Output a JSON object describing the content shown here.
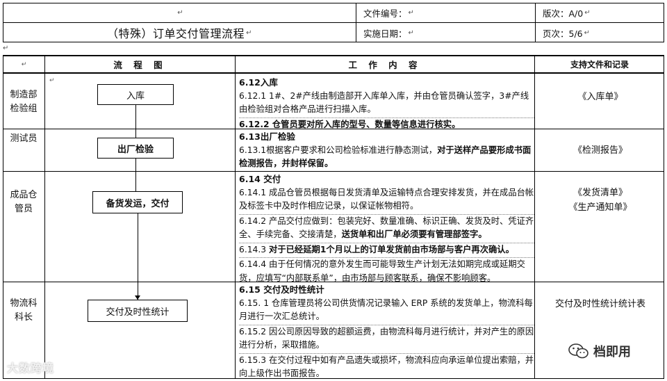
{
  "header": {
    "title_top_mark": "↵",
    "title": "（特殊）订单交付管理流程",
    "doc_no_label": "文件编号：",
    "impl_date_label": "实施日期：",
    "version_label": "版次：A/0",
    "page_label": "页次：5/6",
    "mark": "↵"
  },
  "stray_mark": "↵",
  "table": {
    "col_headers": {
      "dept": "↵",
      "flow": "流 程 图",
      "work": "工 作 内 容",
      "support": "支持文件和记录"
    },
    "rows": [
      {
        "dept": "制造部检验组",
        "dept_line1": "制造部",
        "dept_line2": "检验组",
        "box": "入库",
        "heading": "6.12入库",
        "items": [
          "6.12.1  1#、2#产线由制造部开入库单入库，并由仓管员确认签字，3#产线由检验组对合格产品进行扫描入库。",
          "6.12.2  仓管员要对所入库的型号、数量等信息进行核实。"
        ],
        "support": [
          "《入库单》"
        ]
      },
      {
        "dept_line1": "测试员",
        "box": "出厂检验",
        "heading": "6.13出厂检验",
        "item_plain": "6.13.1根据客户要求和公司检验标准进行静态测试，",
        "item_bold": "对于送样产品要形成书面检测报告，并封样保留。",
        "support": [
          "《检测报告》"
        ]
      },
      {
        "dept_line1": "成品仓",
        "dept_line2": "管员",
        "box": "备货发运，交付",
        "heading": "6.14 交付",
        "item1": "6.14.1 成品仓管员根据每日发货清单及运输特点合理安排发货，并在成品台帐及标签卡中及时作相应记录，以保证帐物相符。",
        "item2_plain": "6.14.2  产品交付应做到：包装完好、数量准确、标识正确、发货及时、凭证齐全、手续完备、交接清楚，",
        "item2_bold": "送货单和出厂单必须要有管理部签字。",
        "item3_plain": "6.14.3  ",
        "item3_bold": "对于已经延期1个月以上的订单发货前由市场部与客户再次确认。",
        "item4": "6.14.4  由于任何情况的意外发生而可能导致生产计划无法如期完成或延期交货，应填写“内部联系单”，由市场部与顾客联系，确保不影响顾客。",
        "support": [
          "《发货清单》",
          "《生产通知单》"
        ]
      },
      {
        "dept_line1": "物流科",
        "dept_line2": "科长",
        "box": "交付及时性统计",
        "heading": "6.15 交付及时性统计",
        "items": [
          "6.15. 1  仓库管理员将公司供货情况记录输入 ERP 系统的发货单上，物流科每月进行一次汇总统计。",
          "6.15.2  因公司原因导致的超额运费，由物流科每月进行统计，并对产生的原因进行分析，采取措施。",
          "6.15.3  在交付过程中如有产品遗失或损坏，物流科应向承运单位提出索赔，并向上级作出书面报告。"
        ],
        "support": [
          "交付及时性统计统计表"
        ]
      }
    ]
  },
  "watermarks": {
    "left": "大数跨境",
    "right": "档即用"
  }
}
